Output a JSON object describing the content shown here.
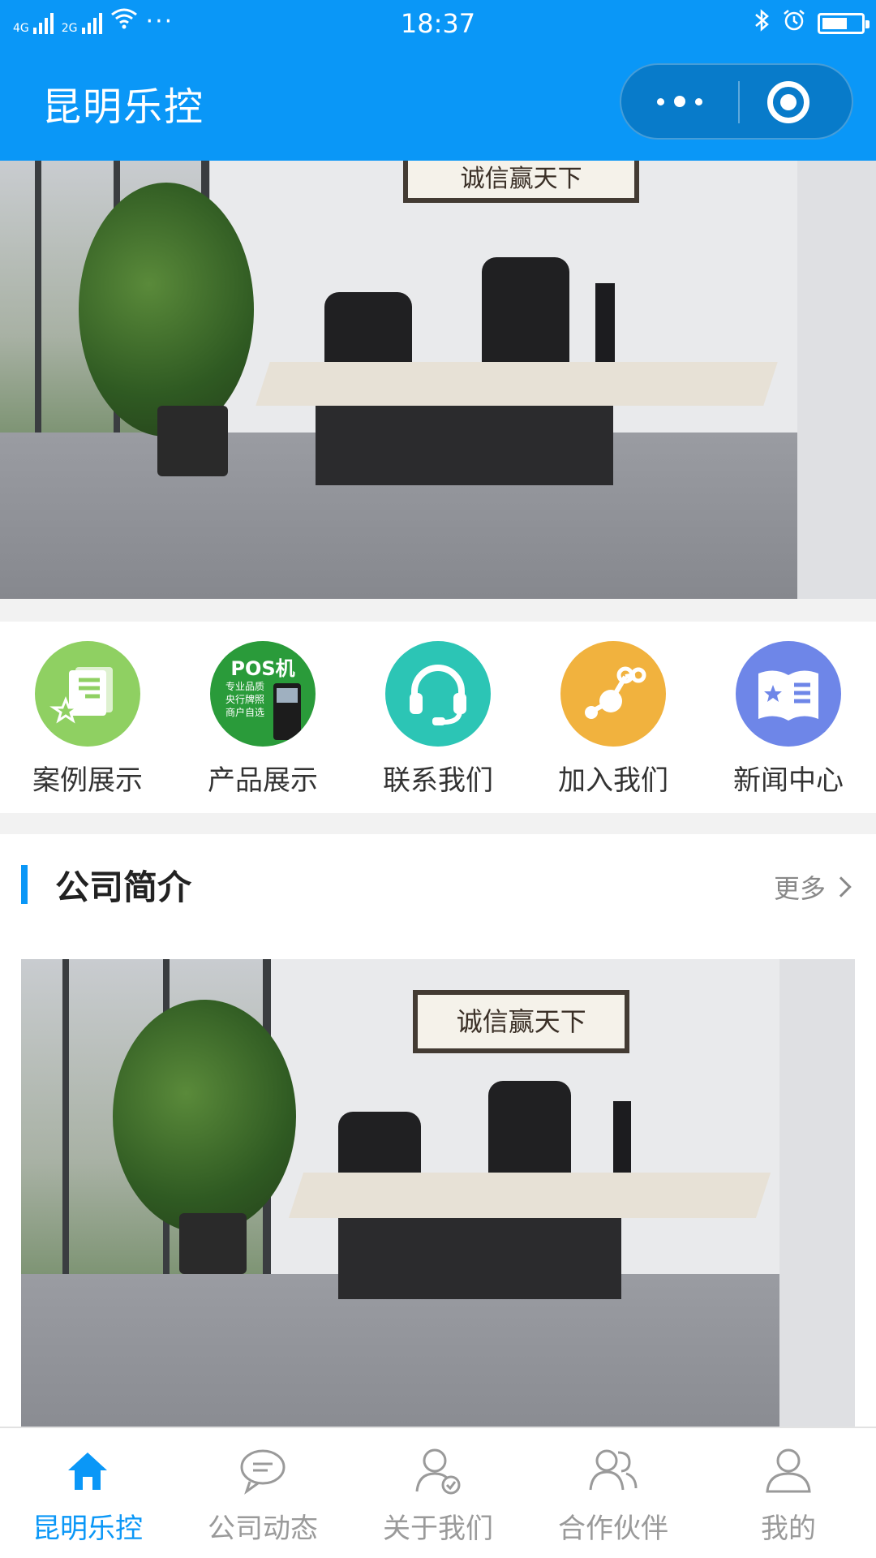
{
  "status_bar": {
    "network_1": "4G",
    "network_2": "2G",
    "overflow": "···",
    "time": "18:37"
  },
  "nav": {
    "title": "昆明乐控"
  },
  "banner": {
    "active_index": 1,
    "dot_count": 3,
    "calligraphy_text": "诚信赢天下"
  },
  "menu": {
    "items": [
      {
        "label": "案例展示",
        "icon": "case-showcase-icon",
        "color": "#8fd062"
      },
      {
        "label": "产品展示",
        "icon": "pos-machine-product-icon",
        "color": "#2a9b3a",
        "img_lines": [
          "POS机",
          "专业品质",
          "央行牌照",
          "商户自选"
        ]
      },
      {
        "label": "联系我们",
        "icon": "headset-icon",
        "color": "#2cc5b5"
      },
      {
        "label": "加入我们",
        "icon": "share-network-icon",
        "color": "#f1b23e"
      },
      {
        "label": "新闻中心",
        "icon": "news-book-icon",
        "color": "#6e86e8"
      }
    ]
  },
  "section": {
    "title": "公司简介",
    "more_label": "更多"
  },
  "tabbar": {
    "active_color": "#0a97f7",
    "inactive_color": "#9a9a9a",
    "items": [
      {
        "label": "昆明乐控",
        "icon": "home-icon",
        "active": true
      },
      {
        "label": "公司动态",
        "icon": "chat-bubble-icon",
        "active": false
      },
      {
        "label": "关于我们",
        "icon": "user-verified-icon",
        "active": false
      },
      {
        "label": "合作伙伴",
        "icon": "partners-icon",
        "active": false
      },
      {
        "label": "我的",
        "icon": "profile-icon",
        "active": false
      }
    ]
  }
}
